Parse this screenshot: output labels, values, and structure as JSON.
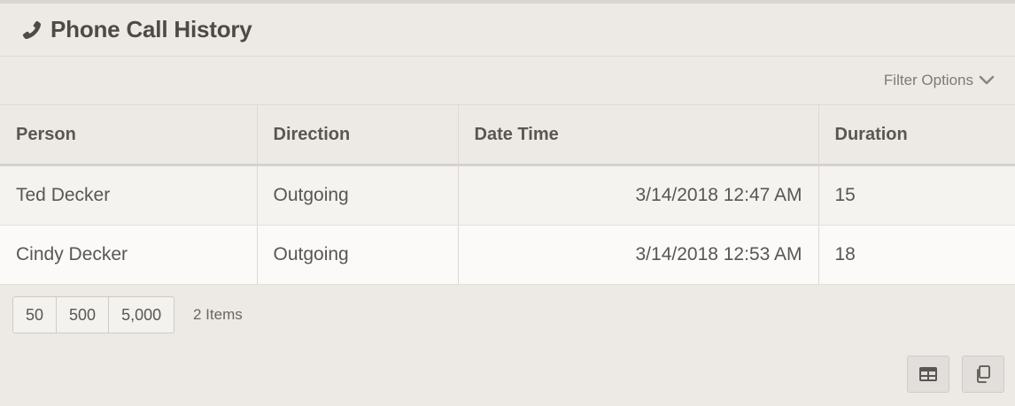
{
  "panel": {
    "title": "Phone Call History",
    "icon": "phone-icon"
  },
  "filter": {
    "label": "Filter Options",
    "icon": "chevron-down-icon"
  },
  "grid": {
    "columns": [
      "Person",
      "Direction",
      "Date Time",
      "Duration"
    ],
    "rows": [
      {
        "person": "Ted Decker",
        "direction": "Outgoing",
        "datetime": "3/14/2018 12:47 AM",
        "duration": "15"
      },
      {
        "person": "Cindy Decker",
        "direction": "Outgoing",
        "datetime": "3/14/2018 12:53 AM",
        "duration": "18"
      }
    ]
  },
  "footer": {
    "page_sizes": [
      "50",
      "500",
      "5,000"
    ],
    "item_count": "2 Items",
    "export_excel_icon": "grid-table-icon",
    "copy_icon": "copy-icon"
  },
  "colors": {
    "panel_bg": "#edeae6",
    "row_odd": "#f5f3f0",
    "row_even": "#fbfaf9",
    "text": "#5a5651"
  }
}
